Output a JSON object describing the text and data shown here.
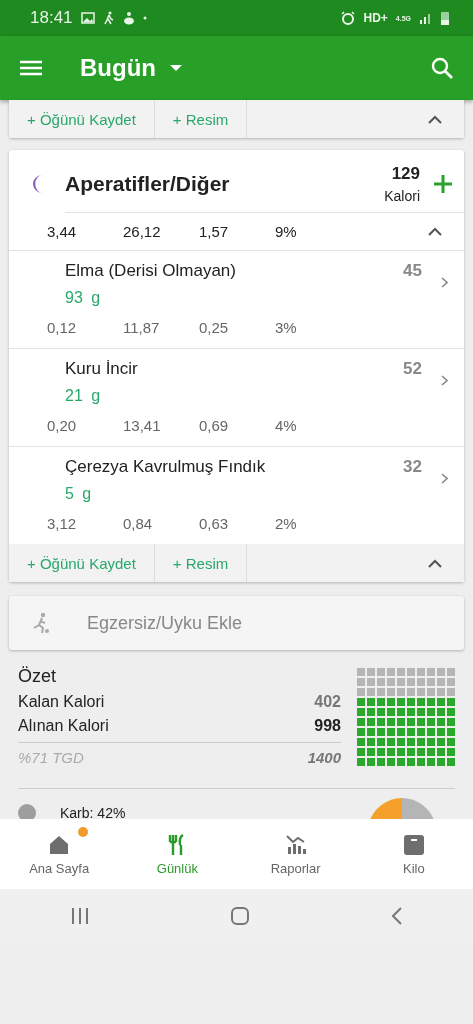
{
  "status_bar": {
    "time": "18:41",
    "network": "HD+",
    "network_type": "4.5G"
  },
  "app_bar": {
    "title": "Bugün"
  },
  "previous_meal": {
    "save": "+ Öğünü Kaydet",
    "photo": "+ Resim",
    "expanded": true
  },
  "meal": {
    "title": "Aperatifler/Diğer",
    "calories": "129",
    "calories_label": "Kalori",
    "totals": [
      "3,44",
      "26,12",
      "1,57",
      "9%"
    ],
    "expanded": true,
    "items": [
      {
        "name": "Elma (Derisi Olmayan)",
        "amount": "93",
        "unit": "g",
        "calories": "45",
        "macros": [
          "0,12",
          "11,87",
          "0,25",
          "3%"
        ]
      },
      {
        "name": "Kuru İncir",
        "amount": "21",
        "unit": "g",
        "calories": "52",
        "macros": [
          "0,20",
          "13,41",
          "0,69",
          "4%"
        ]
      },
      {
        "name": "Çerezya Kavrulmuş Fındık",
        "amount": "5",
        "unit": "g",
        "calories": "32",
        "macros": [
          "3,12",
          "0,84",
          "0,63",
          "2%"
        ]
      }
    ],
    "save": "+ Öğünü Kaydet",
    "photo": "+ Resim"
  },
  "exercise": {
    "label": "Egzersiz/Uyku Ekle"
  },
  "summary": {
    "title": "Özet",
    "rows": [
      {
        "label": "Kalan Kalori",
        "value": "402",
        "kind": "muted"
      },
      {
        "label": "Alınan Kalori",
        "value": "998",
        "kind": "bold"
      }
    ],
    "goal_label": "%71 TGD",
    "goal_value": "1400",
    "level": 0.71
  },
  "macros": {
    "label": "Karb: 42%"
  },
  "bottom_nav": [
    {
      "label": "Ana Sayfa",
      "selected": false,
      "badge": true
    },
    {
      "label": "Günlük",
      "selected": true,
      "badge": false
    },
    {
      "label": "Raporlar",
      "selected": false,
      "badge": false
    },
    {
      "label": "Kilo",
      "selected": false,
      "badge": false
    }
  ]
}
